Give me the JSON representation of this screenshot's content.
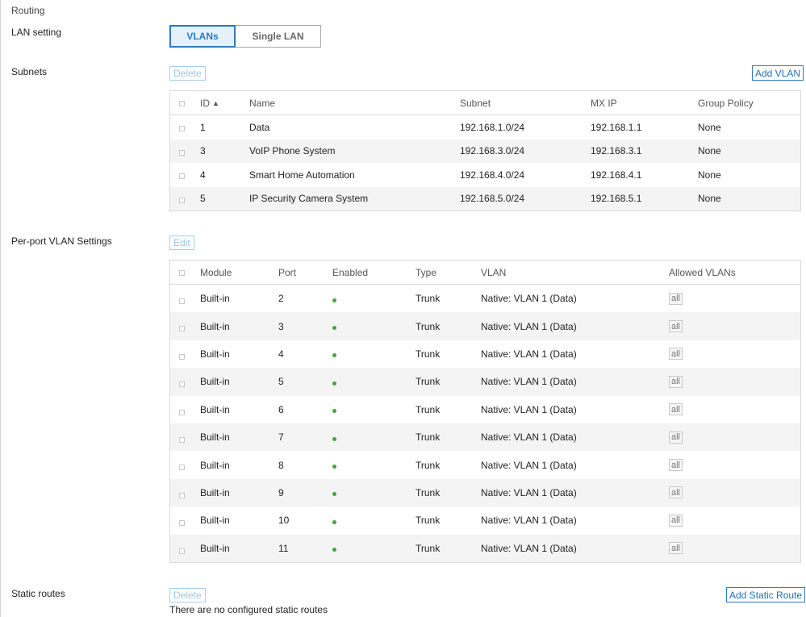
{
  "page": {
    "title": "Routing"
  },
  "lan_setting": {
    "label": "LAN setting",
    "options": [
      "VLANs",
      "Single LAN"
    ],
    "selected": "VLANs"
  },
  "subnets": {
    "label": "Subnets",
    "delete_label": "Delete",
    "add_label": "Add VLAN",
    "headers": {
      "id": "ID",
      "sort_arrow": "▲",
      "name": "Name",
      "subnet": "Subnet",
      "mx_ip": "MX IP",
      "group_policy": "Group Policy"
    },
    "rows": [
      {
        "id": "1",
        "name": "Data",
        "subnet": "192.168.1.0/24",
        "mx_ip": "192.168.1.1",
        "group_policy": "None"
      },
      {
        "id": "3",
        "name": "VoIP Phone System",
        "subnet": "192.168.3.0/24",
        "mx_ip": "192.168.3.1",
        "group_policy": "None"
      },
      {
        "id": "4",
        "name": "Smart Home Automation",
        "subnet": "192.168.4.0/24",
        "mx_ip": "192.168.4.1",
        "group_policy": "None"
      },
      {
        "id": "5",
        "name": "IP Security Camera System",
        "subnet": "192.168.5.0/24",
        "mx_ip": "192.168.5.1",
        "group_policy": "None"
      }
    ]
  },
  "per_port": {
    "label": "Per-port VLAN Settings",
    "edit_label": "Edit",
    "headers": {
      "module": "Module",
      "port": "Port",
      "enabled": "Enabled",
      "type": "Type",
      "vlan": "VLAN",
      "allowed": "Allowed VLANs"
    },
    "rows": [
      {
        "module": "Built-in",
        "port": "2",
        "type": "Trunk",
        "vlan": "Native: VLAN 1 (Data)",
        "allowed": "all"
      },
      {
        "module": "Built-in",
        "port": "3",
        "type": "Trunk",
        "vlan": "Native: VLAN 1 (Data)",
        "allowed": "all"
      },
      {
        "module": "Built-in",
        "port": "4",
        "type": "Trunk",
        "vlan": "Native: VLAN 1 (Data)",
        "allowed": "all"
      },
      {
        "module": "Built-in",
        "port": "5",
        "type": "Trunk",
        "vlan": "Native: VLAN 1 (Data)",
        "allowed": "all"
      },
      {
        "module": "Built-in",
        "port": "6",
        "type": "Trunk",
        "vlan": "Native: VLAN 1 (Data)",
        "allowed": "all"
      },
      {
        "module": "Built-in",
        "port": "7",
        "type": "Trunk",
        "vlan": "Native: VLAN 1 (Data)",
        "allowed": "all"
      },
      {
        "module": "Built-in",
        "port": "8",
        "type": "Trunk",
        "vlan": "Native: VLAN 1 (Data)",
        "allowed": "all"
      },
      {
        "module": "Built-in",
        "port": "9",
        "type": "Trunk",
        "vlan": "Native: VLAN 1 (Data)",
        "allowed": "all"
      },
      {
        "module": "Built-in",
        "port": "10",
        "type": "Trunk",
        "vlan": "Native: VLAN 1 (Data)",
        "allowed": "all"
      },
      {
        "module": "Built-in",
        "port": "11",
        "type": "Trunk",
        "vlan": "Native: VLAN 1 (Data)",
        "allowed": "all"
      }
    ],
    "enabled_color": "#3aa935"
  },
  "static_routes": {
    "label": "Static routes",
    "delete_label": "Delete",
    "add_label": "Add Static Route",
    "empty_text": "There are no configured static routes"
  },
  "colors": {
    "accent": "#2b7bc2",
    "row_alt": "#f4f4f4"
  }
}
